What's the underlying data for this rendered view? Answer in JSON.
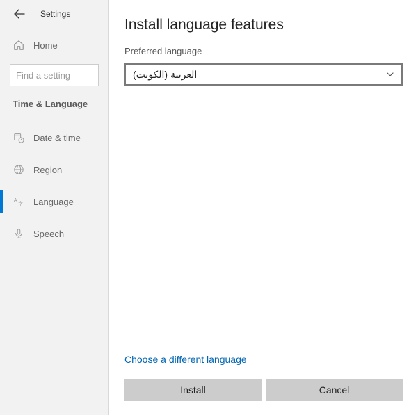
{
  "sidebar": {
    "title": "Settings",
    "home_label": "Home",
    "search_placeholder": "Find a setting",
    "section_heading": "Time & Language",
    "items": [
      {
        "label": "Date & time"
      },
      {
        "label": "Region"
      },
      {
        "label": "Language"
      },
      {
        "label": "Speech"
      }
    ]
  },
  "main": {
    "title": "Install language features",
    "preferred_label": "Preferred language",
    "dropdown_value": "العربية (الكويت)",
    "different_link": "Choose a different language",
    "install_label": "Install",
    "cancel_label": "Cancel"
  }
}
